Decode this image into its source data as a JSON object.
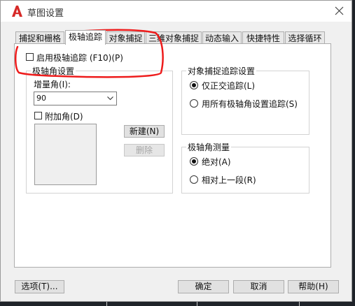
{
  "window": {
    "title": "草图设置",
    "app_icon": "autocad-a-icon",
    "close_icon": "close-icon"
  },
  "tabs": [
    {
      "label": "捕捉和栅格",
      "active": false
    },
    {
      "label": "极轴追踪",
      "active": true
    },
    {
      "label": "对象捕捉",
      "active": false
    },
    {
      "label": "三维对象捕捉",
      "active": false
    },
    {
      "label": "动态输入",
      "active": false
    },
    {
      "label": "快捷特性",
      "active": false
    },
    {
      "label": "选择循环",
      "active": false
    }
  ],
  "polar": {
    "enable_label": "启用极轴追踪 (F10)(P)",
    "enable_checked": false,
    "settings_group": "极轴角设置",
    "increment_label": "增量角(I):",
    "increment_value": "90",
    "additional_label": "附加角(D)",
    "additional_checked": false,
    "new_button": "新建(N)",
    "delete_button": "删除"
  },
  "snap_tracking": {
    "group": "对象捕捉追踪设置",
    "ortho_label": "仅正交追踪(L)",
    "all_label": "用所有极轴角设置追踪(S)",
    "selected": "ortho"
  },
  "measurement": {
    "group": "极轴角测量",
    "absolute_label": "绝对(A)",
    "relative_label": "相对上一段(R)",
    "selected": "absolute"
  },
  "footer": {
    "options_button": "选项(T)...",
    "ok_button": "确定",
    "cancel_button": "取消",
    "help_button": "帮助(H)"
  },
  "colors": {
    "annotation": "#ee1c1c",
    "app_icon": "#d62a28"
  }
}
